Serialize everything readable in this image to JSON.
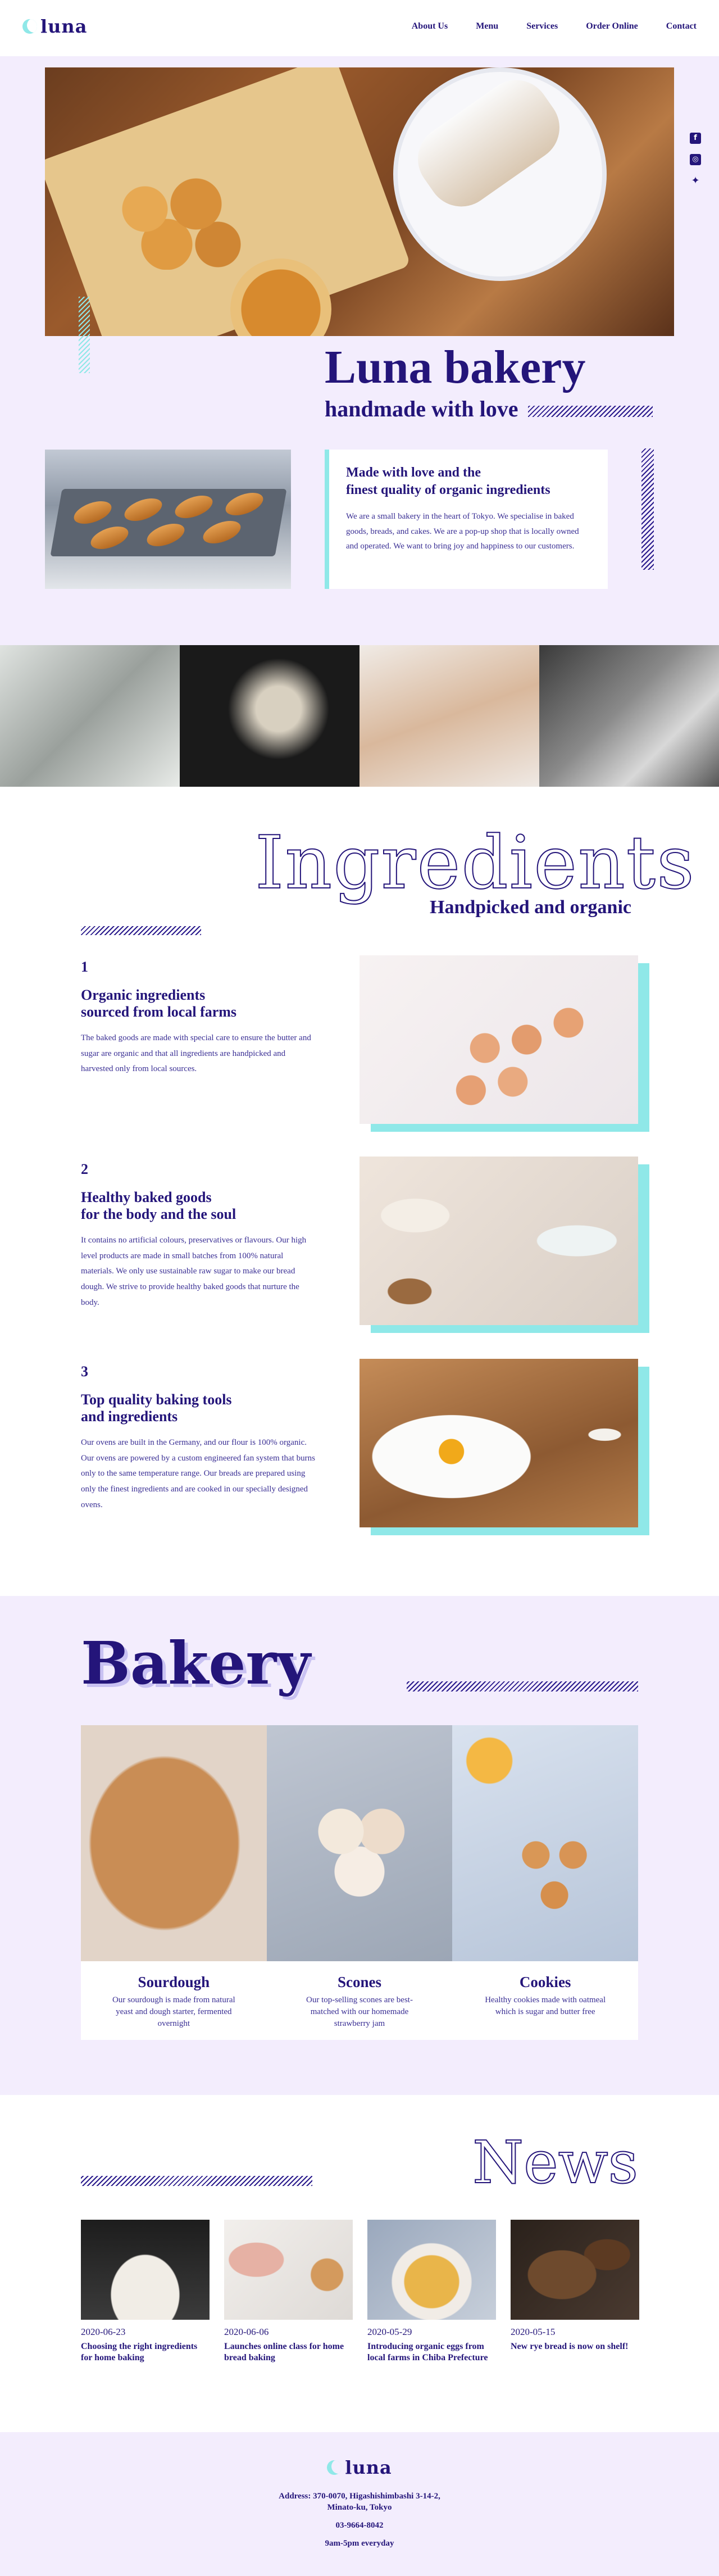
{
  "header": {
    "logo": "luna",
    "nav": [
      "About Us",
      "Menu",
      "Services",
      "Order Online",
      "Contact"
    ]
  },
  "hero": {
    "title": "Luna bakery",
    "subtitle": "handmade with love"
  },
  "about": {
    "title_line1": "Made with love and the",
    "title_line2": "finest quality of organic ingredients",
    "text": "We are a small bakery in the heart of Tokyo. We specialise in baked goods, breads, and cakes. We are a pop-up shop that is locally owned and operated. We want to bring joy and happiness to our customers."
  },
  "social": [
    "facebook-icon",
    "instagram-icon",
    "twitter-icon"
  ],
  "ingredients": {
    "title": "Ingredients",
    "subtitle": "Handpicked and organic",
    "items": [
      {
        "num": "1",
        "head_line1": "Organic ingredients",
        "head_line2": "sourced from local farms",
        "text": "The baked goods are made with special care to ensure the butter and sugar are organic and that all ingredients are handpicked and harvested only from local sources."
      },
      {
        "num": "2",
        "head_line1": "Healthy baked goods",
        "head_line2": "for the body and the soul",
        "text": "It contains no artificial colours, preservatives or flavours. Our high level products are made in small batches from 100% natural materials. We only use sustainable raw sugar to make our bread dough. We strive to provide healthy baked goods that nurture the body."
      },
      {
        "num": "3",
        "head_line1": "Top quality baking tools",
        "head_line2": "and ingredients",
        "text": "Our ovens are built in the Germany, and our flour is 100% organic. Our ovens are powered by a custom engineered fan system that burns only to the same temperature range. Our breads are prepared using only the finest ingredients and are cooked in our specially designed ovens."
      }
    ]
  },
  "bakery": {
    "title": "Bakery",
    "items": [
      {
        "name": "Sourdough",
        "desc": "Our sourdough is made from natural yeast and dough starter, fermented overnight"
      },
      {
        "name": "Scones",
        "desc": "Our top-selling scones are best-matched with our homemade strawberry jam"
      },
      {
        "name": "Cookies",
        "desc": "Healthy cookies made with oatmeal which is sugar and butter free"
      }
    ]
  },
  "news": {
    "title": "News",
    "items": [
      {
        "date": "2020-06-23",
        "title": "Choosing the right ingredients for home baking"
      },
      {
        "date": "2020-06-06",
        "title": "Launches online class for home bread baking"
      },
      {
        "date": "2020-05-29",
        "title": "Introducing organic eggs from local farms in Chiba Prefecture"
      },
      {
        "date": "2020-05-15",
        "title": "New rye bread is now on shelf!"
      }
    ]
  },
  "footer": {
    "logo": "luna",
    "address_line1": "Address: 370-0070, Higashishimbashi 3-14-2,",
    "address_line2": "Minato-ku, Tokyo",
    "phone": "03-9664-8042",
    "hours": "9am-5pm everyday"
  },
  "colors": {
    "brand": "#24157a",
    "accent": "#8fe8e8",
    "section_bg": "#f3edfd"
  }
}
